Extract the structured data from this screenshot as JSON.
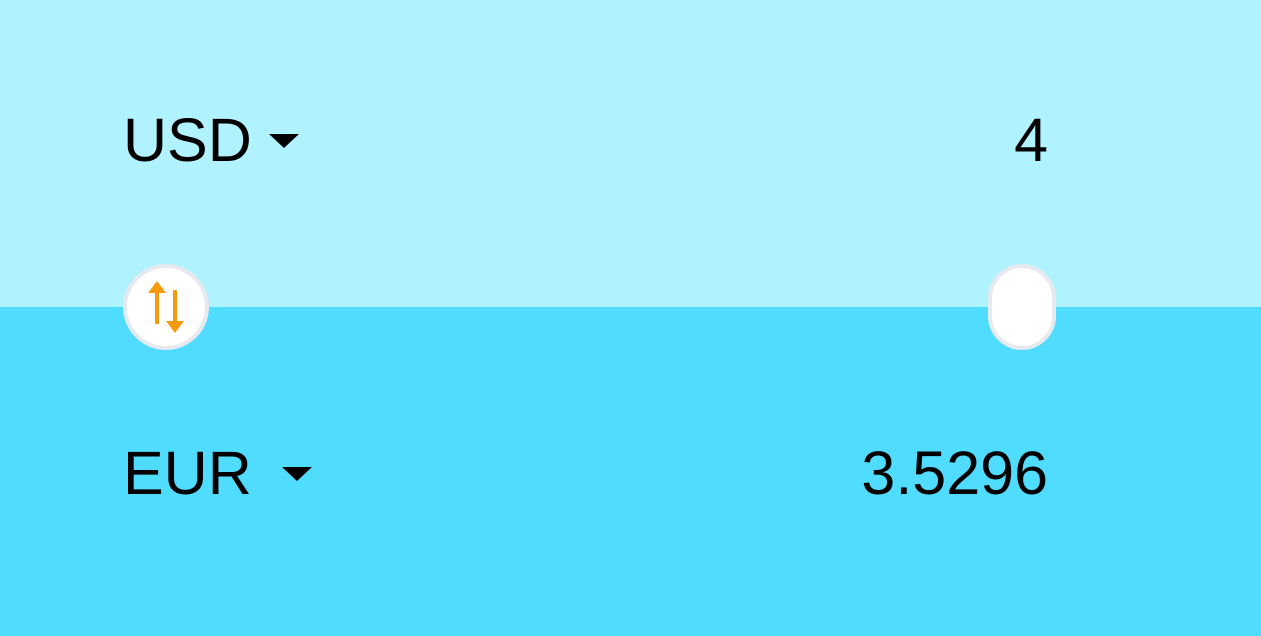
{
  "colors": {
    "top_panel": "#b0f2fd",
    "bottom_panel": "#4fdcfe",
    "swap_icon": "#f59a0b"
  },
  "from": {
    "currency": "USD",
    "amount": "4"
  },
  "to": {
    "currency": "EUR",
    "amount": "3.5296"
  },
  "icons": {
    "swap": "swap-vertical-arrows-icon",
    "dropdown": "caret-down-icon"
  }
}
